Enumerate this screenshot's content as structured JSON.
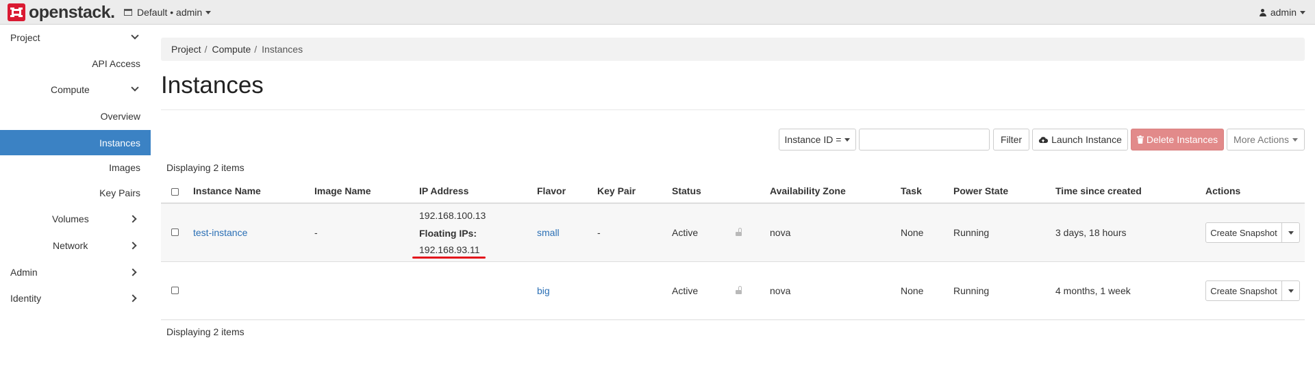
{
  "navbar": {
    "brand": "openstack.",
    "project_switcher": "Default • admin",
    "user": "admin"
  },
  "sidebar": {
    "items": [
      {
        "label": "Project"
      },
      {
        "label": "API Access"
      },
      {
        "label": "Compute"
      },
      {
        "label": "Overview"
      },
      {
        "label": "Instances"
      },
      {
        "label": "Images"
      },
      {
        "label": "Key Pairs"
      },
      {
        "label": "Volumes"
      },
      {
        "label": "Network"
      },
      {
        "label": "Admin"
      },
      {
        "label": "Identity"
      }
    ]
  },
  "breadcrumb": {
    "items": [
      "Project",
      "Compute",
      "Instances"
    ],
    "separator": "/"
  },
  "page": {
    "title": "Instances"
  },
  "toolbar": {
    "filter_select": "Instance ID =",
    "filter_value": "",
    "filter_button": "Filter",
    "launch_button": "Launch Instance",
    "delete_button": "Delete Instances",
    "more_actions": "More Actions"
  },
  "table": {
    "count_text": "Displaying 2 items",
    "columns": [
      "Instance Name",
      "Image Name",
      "IP Address",
      "Flavor",
      "Key Pair",
      "Status",
      "Availability Zone",
      "Task",
      "Power State",
      "Time since created",
      "Actions"
    ],
    "rows": [
      {
        "instance_name": "test-instance",
        "image_name": "-",
        "ip_address": "192.168.100.13",
        "floating_label": "Floating IPs:",
        "floating_ip": "192.168.93.11",
        "flavor": "small",
        "key_pair": "-",
        "status": "Active",
        "availability_zone": "nova",
        "task": "None",
        "power_state": "Running",
        "time_since_created": "3 days, 18 hours",
        "action": "Create Snapshot"
      },
      {
        "instance_name": "",
        "image_name": "",
        "ip_address": "",
        "flavor": "big",
        "key_pair": "",
        "status": "Active",
        "availability_zone": "nova",
        "task": "None",
        "power_state": "Running",
        "time_since_created": "4 months, 1 week",
        "action": "Create Snapshot"
      }
    ]
  },
  "colors": {
    "accent": "#3b82c4",
    "link": "#2a6fb5",
    "danger": "#e28a8a",
    "logo": "#da1a32",
    "annotation": "#e3131b"
  }
}
